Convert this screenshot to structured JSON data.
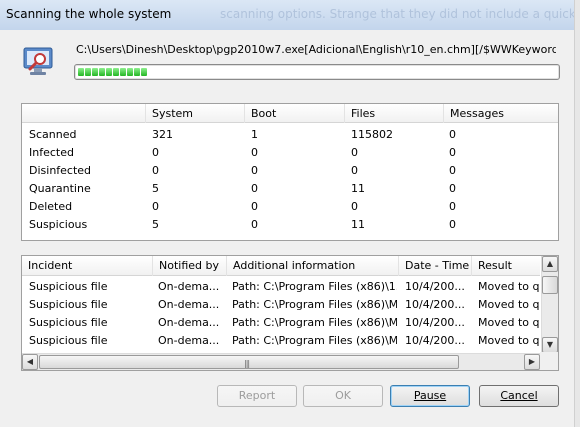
{
  "window": {
    "title": "Scanning the whole system",
    "ghost_text": "scanning options. Strange that they did not include a quick sc"
  },
  "scan": {
    "current_path": "C:\\Users\\Dinesh\\Desktop\\pgp2010w7.exe[Adicional\\English\\r10_en.chm][/$WWKeywordLinks/Data]",
    "progress_percent": 14,
    "progress_segments": 10
  },
  "stats": {
    "columns": [
      "",
      "System",
      "Boot",
      "Files",
      "Messages"
    ],
    "rows": [
      {
        "label": "Scanned",
        "system": "321",
        "boot": "1",
        "files": "115802",
        "messages": "0"
      },
      {
        "label": "Infected",
        "system": "0",
        "boot": "0",
        "files": "0",
        "messages": "0"
      },
      {
        "label": "Disinfected",
        "system": "0",
        "boot": "0",
        "files": "0",
        "messages": "0"
      },
      {
        "label": "Quarantine",
        "system": "5",
        "boot": "0",
        "files": "11",
        "messages": "0"
      },
      {
        "label": "Deleted",
        "system": "0",
        "boot": "0",
        "files": "0",
        "messages": "0"
      },
      {
        "label": "Suspicious",
        "system": "5",
        "boot": "0",
        "files": "11",
        "messages": "0"
      }
    ]
  },
  "incidents": {
    "columns": [
      "Incident",
      "Notified by",
      "Additional information",
      "Date - Time",
      "Result"
    ],
    "rows": [
      {
        "incident": "Suspicious file",
        "notified": "On-dema...",
        "info": "Path: C:\\Program Files (x86)\\1...",
        "date": "10/4/200...",
        "result": "Moved to qua"
      },
      {
        "incident": "Suspicious file",
        "notified": "On-dema...",
        "info": "Path: C:\\Program Files (x86)\\M...",
        "date": "10/4/200...",
        "result": "Moved to qua"
      },
      {
        "incident": "Suspicious file",
        "notified": "On-dema...",
        "info": "Path: C:\\Program Files (x86)\\M...",
        "date": "10/4/200...",
        "result": "Moved to qua"
      },
      {
        "incident": "Suspicious file",
        "notified": "On-dema...",
        "info": "Path: C:\\Program Files (x86)\\M...",
        "date": "10/4/200...",
        "result": "Moved to qua"
      }
    ]
  },
  "buttons": {
    "report": "Report",
    "ok": "OK",
    "pause": "Pause",
    "cancel": "Cancel"
  },
  "colors": {
    "progress_green": "#23b623",
    "window_bg": "#f0f0f0",
    "default_button_border": "#3c7fb1"
  },
  "icons": {
    "scan_icon": "monitor-magnifier-icon",
    "scroll_up": "arrow-up-icon",
    "scroll_down": "arrow-down-icon",
    "scroll_left": "arrow-left-icon",
    "scroll_right": "arrow-right-icon"
  }
}
